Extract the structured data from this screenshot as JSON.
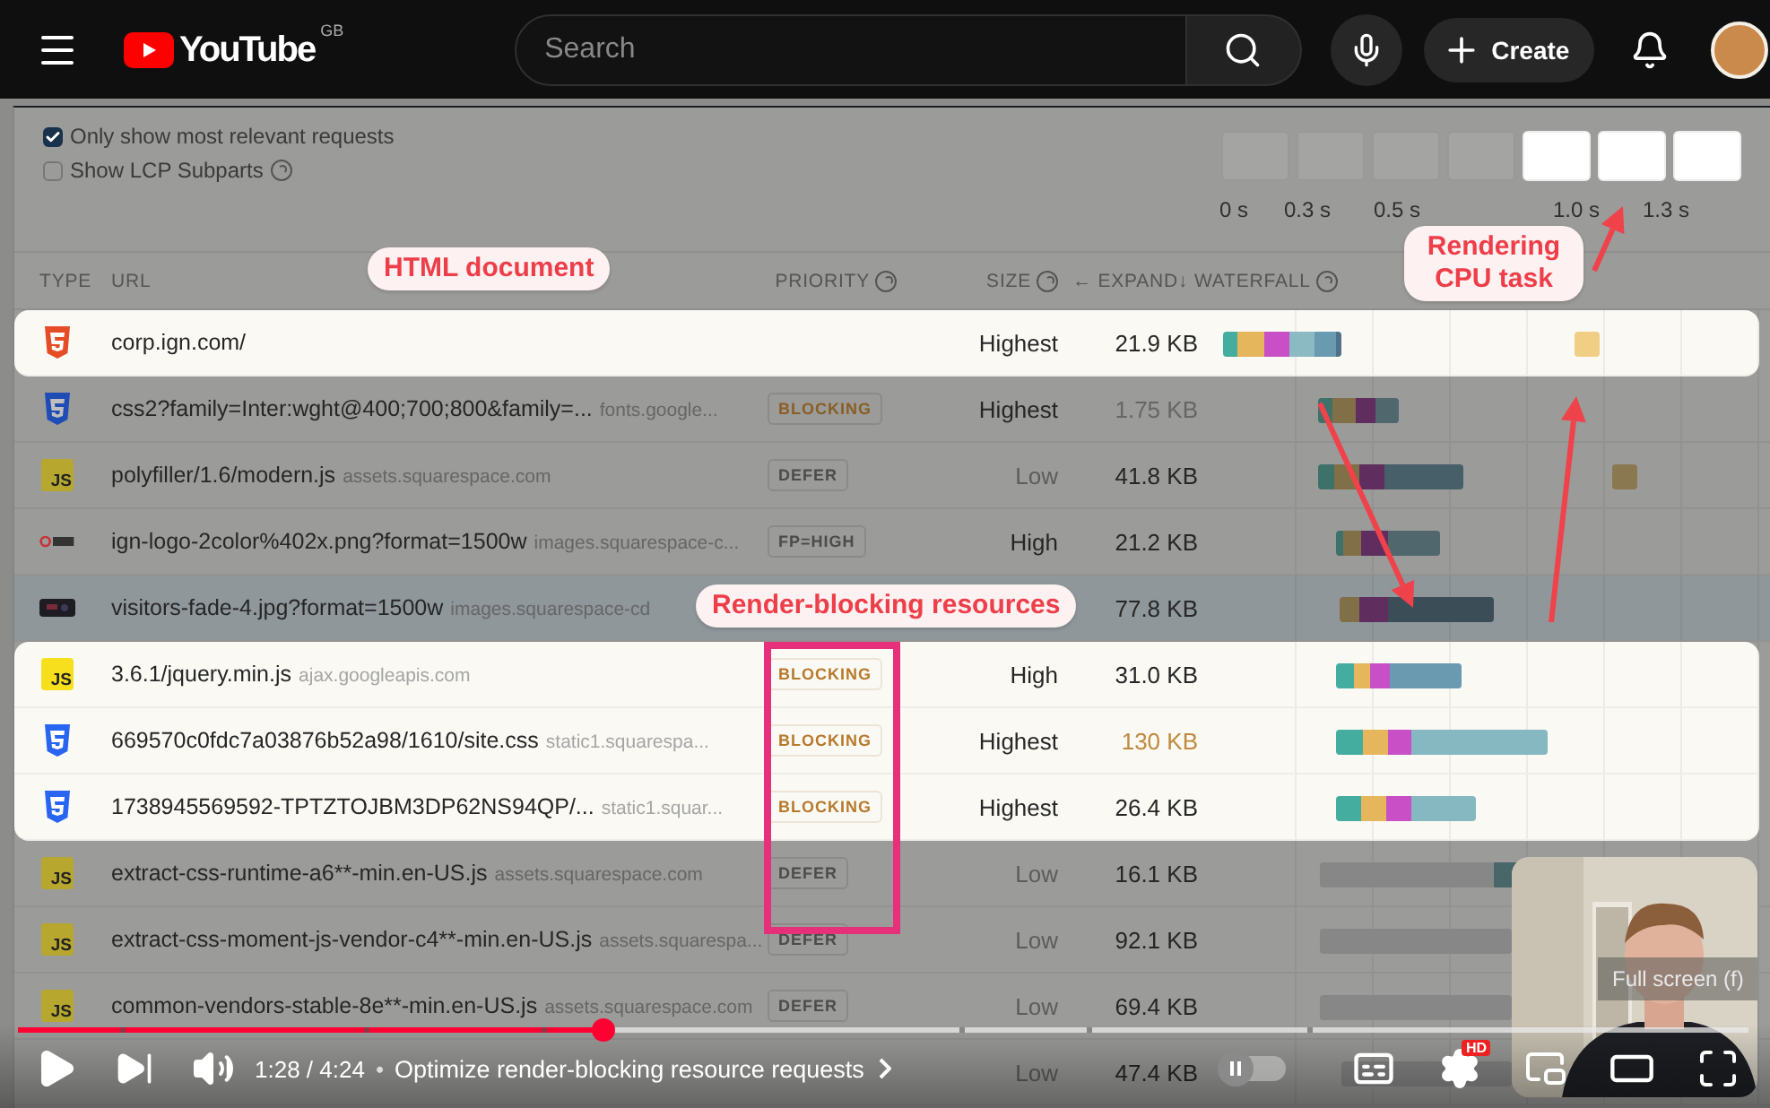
{
  "header": {
    "logo": {
      "text": "YouTube",
      "region": "GB"
    },
    "search": {
      "placeholder": "Search"
    },
    "create": {
      "label": "Create"
    }
  },
  "video": {
    "filters": [
      {
        "label": "Only show most relevant requests",
        "checked": true,
        "help": false
      },
      {
        "label": "Show LCP Subparts",
        "checked": false,
        "help": true
      }
    ],
    "filmstrip": [
      {
        "highlighted": false
      },
      {
        "highlighted": false
      },
      {
        "highlighted": false
      },
      {
        "highlighted": false
      },
      {
        "highlighted": true
      },
      {
        "highlighted": true
      },
      {
        "highlighted": true
      }
    ],
    "ticks": [
      "0 s",
      "0.3 s",
      "0.5 s",
      "1.0 s",
      "1.3 s"
    ],
    "columns": [
      {
        "label": "TYPE",
        "help": false
      },
      {
        "label": "URL",
        "help": false
      },
      {
        "label": "PRIORITY",
        "help": true
      },
      {
        "label": "SIZE",
        "help": true
      },
      {
        "label": "← EXPAND",
        "help": false
      },
      {
        "label": "↓ WATERFALL",
        "help": true
      }
    ],
    "rows": [
      {
        "kind": "html",
        "url": "corp.ign.com/",
        "priority": "Highest",
        "priority_muted": false,
        "size": "21.9 KB",
        "size_muted": false,
        "size_large": false,
        "highlighted": true,
        "selected": false
      },
      {
        "kind": "css",
        "url": "css2?family=Inter:wght@400;700;800&family=...",
        "host": "fonts.google...",
        "tag": {
          "label": "BLOCKING",
          "kind": "blocking"
        },
        "priority": "Highest",
        "priority_muted": false,
        "size": "1.75 KB",
        "size_muted": true,
        "size_large": false,
        "highlighted": false,
        "selected": false
      },
      {
        "kind": "js",
        "icon_label": "JS",
        "url": "polyfiller/1.6/modern.js",
        "host": "assets.squarespace.com",
        "tag": {
          "label": "DEFER",
          "kind": "defer"
        },
        "priority": "Low",
        "priority_muted": true,
        "size": "41.8 KB",
        "size_muted": false,
        "size_large": false,
        "highlighted": false,
        "selected": false
      },
      {
        "kind": "logo",
        "url": "ign-logo-2color%402x.png?format=1500w",
        "host": "images.squarespace-c...",
        "tag": {
          "label": "FP=HIGH",
          "kind": "hint"
        },
        "priority": "High",
        "priority_muted": false,
        "size": "21.2 KB",
        "size_muted": false,
        "size_large": false,
        "highlighted": false,
        "selected": false
      },
      {
        "url": "visitors-fade-4.jpg?format=1500w",
        "host": "images.squarespace-cd",
        "size": "77.8 KB",
        "size_muted": false,
        "size_large": false,
        "highlighted": false,
        "selected": true
      },
      {
        "kind": "js",
        "icon_label": "JS",
        "url": "3.6.1/jquery.min.js",
        "host": "ajax.googleapis.com",
        "tag": {
          "label": "BLOCKING",
          "kind": "blocking"
        },
        "priority": "High",
        "priority_muted": false,
        "size": "31.0 KB",
        "size_muted": false,
        "size_large": false,
        "highlighted": true,
        "selected": false
      },
      {
        "kind": "css",
        "url": "669570c0fdc7a03876b52a98/1610/site.css",
        "host": "static1.squarespa...",
        "tag": {
          "label": "BLOCKING",
          "kind": "blocking"
        },
        "priority": "Highest",
        "priority_muted": false,
        "size": "130 KB",
        "size_muted": false,
        "size_large": true,
        "highlighted": true,
        "selected": false
      },
      {
        "kind": "css",
        "url": "1738945569592-TPTZTOJBM3DP62NS94QP/...",
        "host": "static1.squar...",
        "tag": {
          "label": "BLOCKING",
          "kind": "blocking"
        },
        "priority": "Highest",
        "priority_muted": false,
        "size": "26.4 KB",
        "size_muted": false,
        "size_large": false,
        "highlighted": true,
        "selected": false
      },
      {
        "kind": "js",
        "icon_label": "JS",
        "url": "extract-css-runtime-a6**-min.en-US.js",
        "host": "assets.squarespace.com",
        "tag": {
          "label": "DEFER",
          "kind": "defer"
        },
        "priority": "Low",
        "priority_muted": true,
        "size": "16.1 KB",
        "size_muted": false,
        "size_large": false,
        "highlighted": false,
        "selected": false
      },
      {
        "kind": "js",
        "icon_label": "JS",
        "url": "extract-css-moment-js-vendor-c4**-min.en-US.js",
        "host": "assets.squarespa...",
        "tag": {
          "label": "DEFER",
          "kind": "defer"
        },
        "priority": "Low",
        "priority_muted": true,
        "size": "92.1 KB",
        "size_muted": false,
        "size_large": false,
        "highlighted": false,
        "selected": false
      },
      {
        "kind": "js",
        "icon_label": "JS",
        "url": "common-vendors-stable-8e**-min.en-US.js",
        "host": "assets.squarespace.com",
        "tag": {
          "label": "DEFER",
          "kind": "defer"
        },
        "priority": "Low",
        "priority_muted": true,
        "size": "69.4 KB",
        "size_muted": false,
        "size_large": false,
        "highlighted": false,
        "selected": false
      },
      {
        "priority": "Low",
        "priority_muted": true,
        "size": "47.4 KB",
        "size_muted": false,
        "size_large": false,
        "highlighted": false,
        "selected": false
      }
    ],
    "callouts": [
      {
        "text": "HTML document"
      },
      {
        "text": "Rendering CPU task"
      },
      {
        "text": "Render-blocking resources"
      }
    ]
  },
  "player": {
    "progress": {
      "level": 0.338
    },
    "time": "1:28 / 4:24",
    "separator": "•",
    "chapter": "Optimize render-blocking resource requests",
    "autoplay": {
      "on": false
    },
    "quality_badge": "HD",
    "tooltip": "Full screen (f)"
  }
}
